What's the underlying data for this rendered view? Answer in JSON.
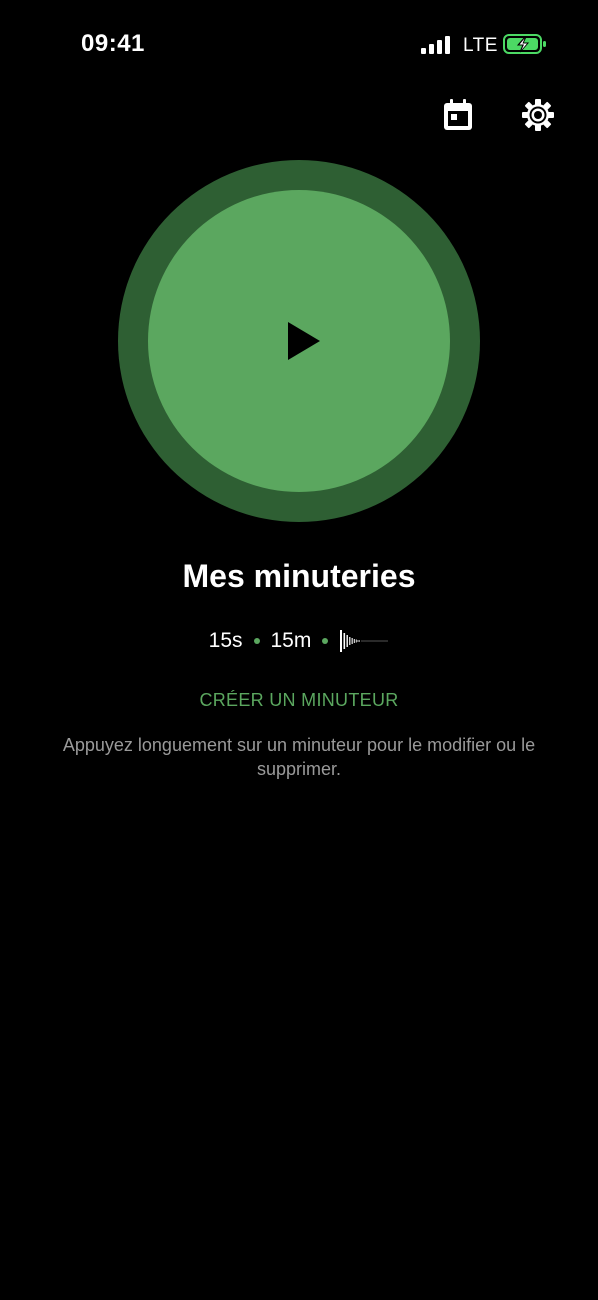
{
  "status_bar": {
    "time": "09:41",
    "network": "LTE",
    "signal_bars": 4,
    "battery_charging": true
  },
  "toolbar": {
    "calendar_icon": "calendar-icon",
    "settings_icon": "gear-icon"
  },
  "player": {
    "icon": "play-icon"
  },
  "timers": {
    "title": "Mes minuteries",
    "items": [
      "15s",
      "15m"
    ],
    "sound_icon": "waveform-icon"
  },
  "actions": {
    "create_label": "CRÉER UN MINUTEUR",
    "hint": "Appuyez longuement sur un minuteur pour le modifier ou le supprimer."
  },
  "colors": {
    "background": "#000000",
    "accent": "#5ba75f",
    "ring": "#2e5f33",
    "hint": "#9a9a9a",
    "battery_fill": "#4cd964"
  }
}
